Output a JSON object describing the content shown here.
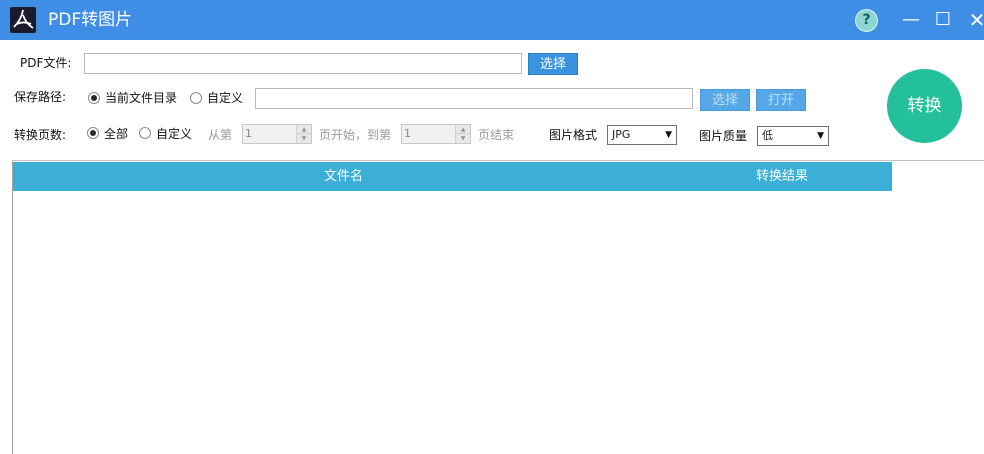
{
  "window": {
    "title": "PDF转图片",
    "help_label": "?",
    "minimize_label": "—",
    "maximize_label": "☐",
    "close_label": "✕"
  },
  "pdf_file": {
    "label": "PDF文件:",
    "value": "",
    "select_button": "选择"
  },
  "save_path": {
    "label": "保存路径:",
    "option_current": "当前文件目录",
    "option_custom": "自定义",
    "selected": "current",
    "value": "",
    "select_button": "选择",
    "open_button": "打开"
  },
  "pages": {
    "label": "转换页数:",
    "option_all": "全部",
    "option_custom": "自定义",
    "selected": "all",
    "from_label": "从第",
    "from_value": "1",
    "start_label": "页开始，到第",
    "to_value": "1",
    "end_label": "页结束"
  },
  "format": {
    "label": "图片格式",
    "value": "JPG"
  },
  "quality": {
    "label": "图片质量",
    "value": "低"
  },
  "convert_button": "转换",
  "table": {
    "columns": [
      "文件名",
      "转换结果"
    ],
    "rows": []
  }
}
